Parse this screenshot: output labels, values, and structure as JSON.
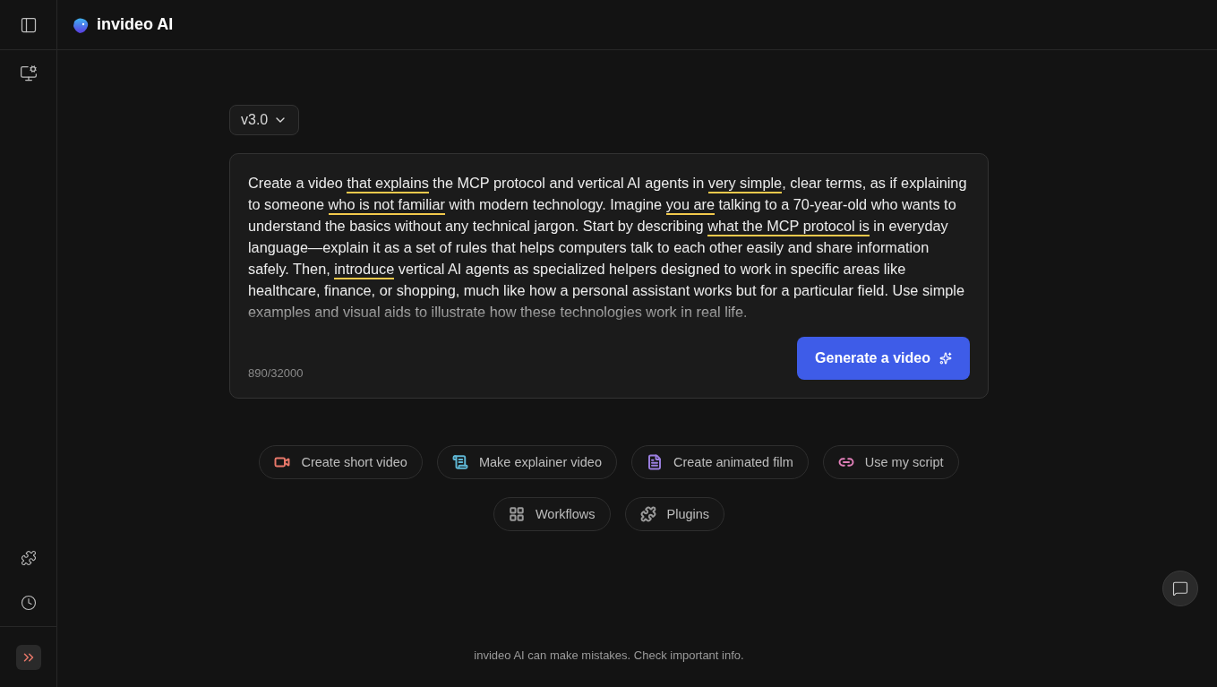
{
  "brand": {
    "name": "invideo AI"
  },
  "version": {
    "label": "v3.0"
  },
  "prompt": {
    "segments": [
      {
        "text": "Create a video ",
        "underlined": false
      },
      {
        "text": "that explains",
        "underlined": true
      },
      {
        "text": " the MCP protocol and vertical AI agents in ",
        "underlined": false
      },
      {
        "text": "very simple",
        "underlined": true
      },
      {
        "text": ", clear terms, as if explaining to someone ",
        "underlined": false
      },
      {
        "text": "who is not familiar",
        "underlined": true
      },
      {
        "text": " with modern technology. Imagine ",
        "underlined": false
      },
      {
        "text": "you are",
        "underlined": true
      },
      {
        "text": " talking to a 70-year-old who wants to understand the basics without any technical jargon. Start by describing ",
        "underlined": false
      },
      {
        "text": "what the MCP protocol is",
        "underlined": true
      },
      {
        "text": " in everyday language—explain it as a set of rules that helps computers talk to each other easily and share information safely. Then, ",
        "underlined": false
      },
      {
        "text": "introduce",
        "underlined": true
      },
      {
        "text": " vertical AI agents as specialized helpers designed to work in specific areas like healthcare, finance, or shopping, much like how a personal assistant works but for a particular field. Use simple examples and visual aids to illustrate how these technologies work in real life.",
        "underlined": false
      }
    ],
    "counter": "890/32000",
    "submit": "Generate a video"
  },
  "chips": [
    {
      "label": "Create short video",
      "kind": "video",
      "color": "#e8786a"
    },
    {
      "label": "Make explainer video",
      "kind": "scroll",
      "color": "#5fb8d6"
    },
    {
      "label": "Create animated film",
      "kind": "list",
      "color": "#9b7fe0"
    },
    {
      "label": "Use my script",
      "kind": "link",
      "color": "#e07fb8"
    },
    {
      "label": "Workflows",
      "kind": "grid",
      "color": "#9a9a9a"
    },
    {
      "label": "Plugins",
      "kind": "puzzle",
      "color": "#9a9a9a"
    }
  ],
  "footer": "invideo AI can make mistakes. Check important info."
}
